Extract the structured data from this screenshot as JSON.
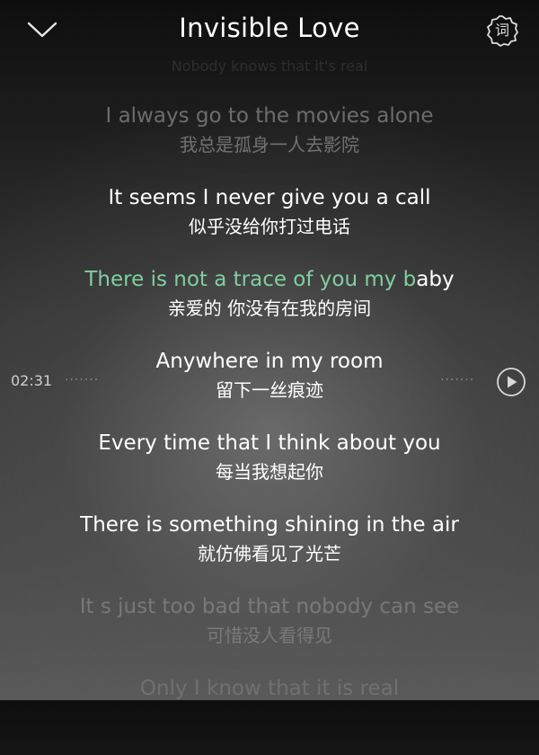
{
  "header": {
    "title": "Invisible Love",
    "collapse_icon": "chevron-down-icon",
    "lyric_setting_label": "词"
  },
  "ghost_line": "Nobody knows that it's real",
  "player": {
    "current_time": "02:31",
    "dots": "·······",
    "play_icon": "play-icon"
  },
  "colors": {
    "highlight": "#7fcfa2",
    "text": "#ffffff"
  },
  "lyrics": [
    {
      "en": "I always go to the movies alone",
      "zh": "我总是孤身一人去影院"
    },
    {
      "en": "It seems I never give you a call",
      "zh": "似乎没给你打过电话"
    },
    {
      "en_played": "There is not a trace of you  my b",
      "en_rest": "aby",
      "zh": "亲爱的 你没有在我的房间"
    },
    {
      "en": "Anywhere in my room",
      "zh": "留下一丝痕迹"
    },
    {
      "en": "Every time that I think about you",
      "zh": "每当我想起你"
    },
    {
      "en": "There is something shining in the air",
      "zh": "就仿佛看见了光芒"
    },
    {
      "en": "It s just too bad that nobody can see",
      "zh": "可惜没人看得见"
    },
    {
      "en": "Only I know that it is real"
    }
  ]
}
